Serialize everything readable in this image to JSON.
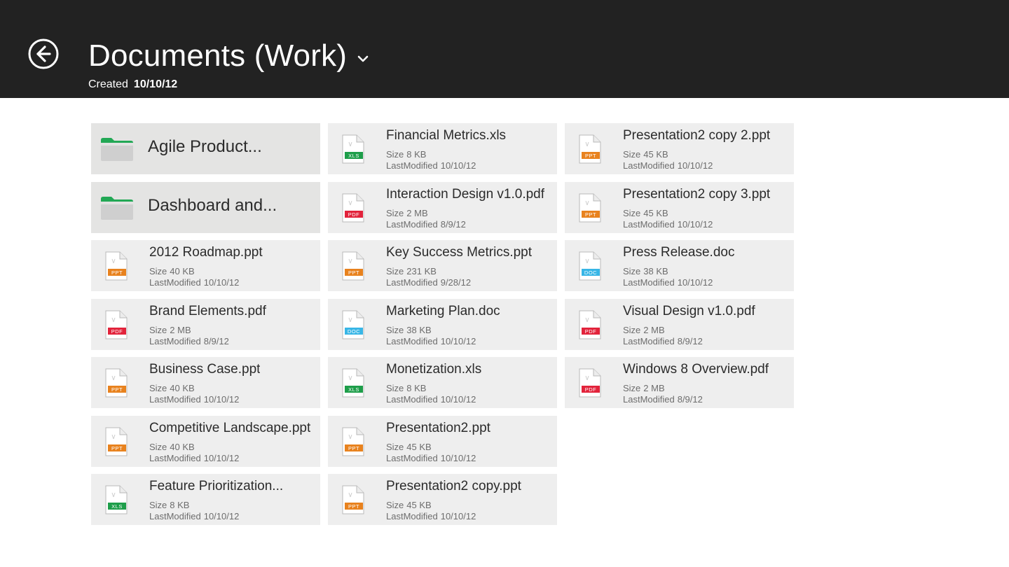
{
  "header": {
    "title": "Documents (Work)",
    "created_label": "Created",
    "created_value": "10/10/12"
  },
  "labels": {
    "size": "Size",
    "last_modified": "LastModified"
  },
  "colors": {
    "header_bg": "#222222",
    "ppt": "#e8821e",
    "pdf": "#e2233b",
    "xls": "#1e9e4a",
    "doc": "#38b6e6",
    "folder_tab": "#22a855"
  },
  "folders": [
    {
      "name": "Agile Product..."
    },
    {
      "name": "Dashboard and..."
    }
  ],
  "files": [
    {
      "name": "2012 Roadmap.ppt",
      "type": "PPT",
      "size": "40 KB",
      "modified": "10/10/12"
    },
    {
      "name": "Brand Elements.pdf",
      "type": "PDF",
      "size": "2 MB",
      "modified": "8/9/12"
    },
    {
      "name": "Business Case.ppt",
      "type": "PPT",
      "size": "40 KB",
      "modified": "10/10/12"
    },
    {
      "name": "Competitive Landscape.ppt",
      "type": "PPT",
      "size": "40 KB",
      "modified": "10/10/12"
    },
    {
      "name": "Feature Prioritization...",
      "type": "XLS",
      "size": "8 KB",
      "modified": "10/10/12"
    },
    {
      "name": "Financial Metrics.xls",
      "type": "XLS",
      "size": "8 KB",
      "modified": "10/10/12"
    },
    {
      "name": "Interaction Design v1.0.pdf",
      "type": "PDF",
      "size": "2 MB",
      "modified": "8/9/12"
    },
    {
      "name": "Key Success Metrics.ppt",
      "type": "PPT",
      "size": "231 KB",
      "modified": "9/28/12"
    },
    {
      "name": "Marketing Plan.doc",
      "type": "DOC",
      "size": "38 KB",
      "modified": "10/10/12"
    },
    {
      "name": "Monetization.xls",
      "type": "XLS",
      "size": "8 KB",
      "modified": "10/10/12"
    },
    {
      "name": "Presentation2.ppt",
      "type": "PPT",
      "size": "45 KB",
      "modified": "10/10/12"
    },
    {
      "name": "Presentation2 copy.ppt",
      "type": "PPT",
      "size": "45 KB",
      "modified": "10/10/12"
    },
    {
      "name": "Presentation2 copy 2.ppt",
      "type": "PPT",
      "size": "45 KB",
      "modified": "10/10/12"
    },
    {
      "name": "Presentation2 copy 3.ppt",
      "type": "PPT",
      "size": "45 KB",
      "modified": "10/10/12"
    },
    {
      "name": "Press Release.doc",
      "type": "DOC",
      "size": "38 KB",
      "modified": "10/10/12"
    },
    {
      "name": "Visual Design v1.0.pdf",
      "type": "PDF",
      "size": "2 MB",
      "modified": "8/9/12"
    },
    {
      "name": "Windows 8 Overview.pdf",
      "type": "PDF",
      "size": "2 MB",
      "modified": "8/9/12"
    }
  ]
}
